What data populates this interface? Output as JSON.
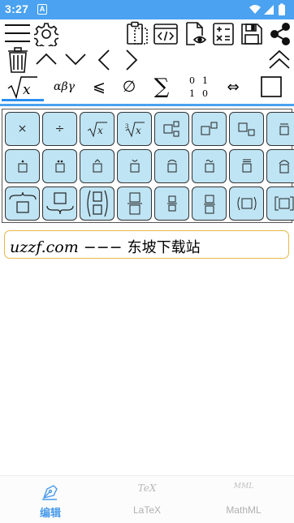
{
  "status_bar": {
    "time": "3:27",
    "notification_badge": "A",
    "icons": [
      "wifi-icon",
      "signal-icon",
      "battery-icon"
    ]
  },
  "toolbar": {
    "row1_left": [
      "menu-icon",
      "settings-icon"
    ],
    "row1_right": [
      "clipboard-paste-icon",
      "code-icon",
      "preview-document-icon",
      "calculator-notes-icon",
      "save-icon",
      "share-icon"
    ],
    "row2": [
      "trash-icon",
      "chevron-up-icon",
      "chevron-down-icon",
      "chevron-left-icon",
      "chevron-right-icon",
      "double-chevron-up-icon"
    ]
  },
  "symbol_tabs": [
    {
      "name": "tab-radicals",
      "label": "√x",
      "active": true
    },
    {
      "name": "tab-greek",
      "label": "αβγ",
      "active": false
    },
    {
      "name": "tab-relations",
      "label": "⩽",
      "active": false
    },
    {
      "name": "tab-sets",
      "label": "∅",
      "active": false
    },
    {
      "name": "tab-operators",
      "label": "∑",
      "active": false
    },
    {
      "name": "tab-matrices",
      "label": "0 1 / 1 0",
      "active": false
    },
    {
      "name": "tab-arrows",
      "label": "⇔",
      "active": false
    },
    {
      "name": "tab-box",
      "label": "□",
      "active": false
    }
  ],
  "keys": [
    [
      "×",
      "÷",
      "√x",
      "∛x",
      "□□ sub-super",
      "□ superscript",
      "□ subscript",
      "□ bar"
    ],
    [
      "□ dot",
      "□ ddot",
      "□ hat",
      "□ breve",
      "□ arc",
      "□ tilde",
      "□ double-bar",
      "□ arch"
    ],
    [
      "overbrace □",
      "underbrace □",
      "(□ □) binom",
      "□/□ frac",
      "□ small-frac",
      "□ tfrac",
      "(□)",
      "[□]"
    ]
  ],
  "editor": {
    "math_text": "uzzf.com",
    "dashes": "−−−",
    "chinese_text": "东坡下载站"
  },
  "bottom_nav": [
    {
      "name": "nav-editor",
      "icon_text": "",
      "label": "编辑",
      "active": true
    },
    {
      "name": "nav-latex",
      "icon_text": "TeX",
      "label": "LaTeX",
      "active": false
    },
    {
      "name": "nav-mathml",
      "icon_text": "MML",
      "label": "MathML",
      "active": false
    }
  ],
  "colors": {
    "status_bar": "#4aa2f0",
    "key_fill": "#bfe4f4",
    "accent": "#4a9bea",
    "editor_border": "#e8b84a"
  }
}
